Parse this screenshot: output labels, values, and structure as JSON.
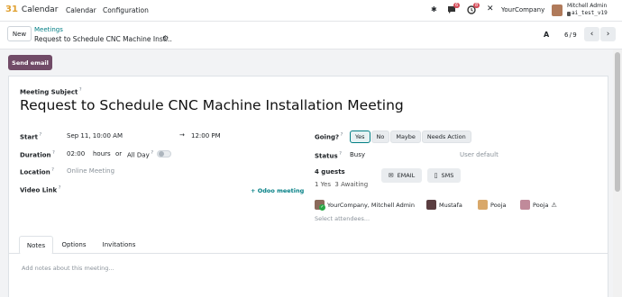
{
  "app": {
    "logo_number": "31",
    "name": "Calendar"
  },
  "menu": {
    "calendar": "Calendar",
    "configuration": "Configuration"
  },
  "systray": {
    "messages_count": "6",
    "activity_count": "8",
    "company": "YourCompany",
    "user_name": "Mitchell Admin",
    "user_db": "ai_test_v19"
  },
  "breadcrumb": {
    "new_label": "New",
    "parent": "Meetings",
    "current": "Request to Schedule CNC Machine Inst..."
  },
  "pager": {
    "value": "6 / 9"
  },
  "actions": {
    "send_email": "Send email"
  },
  "form": {
    "subject_label": "Meeting Subject",
    "subject": "Request to Schedule CNC Machine Installation Meeting",
    "start_label": "Start",
    "start_value": "Sep 11, 10:00 AM",
    "end_value": "12:00 PM",
    "duration_label": "Duration",
    "duration_value": "02:00",
    "duration_unit": "hours",
    "or_text": "or",
    "allday_label": "All Day",
    "location_label": "Location",
    "location_placeholder": "Online Meeting",
    "video_label": "Video Link",
    "odoo_meeting": "Odoo meeting",
    "going_label": "Going?",
    "going_options": [
      "Yes",
      "No",
      "Maybe",
      "Needs Action"
    ],
    "status_label": "Status",
    "status_value": "Busy",
    "user_default": "User default",
    "guests_count": "4 guests",
    "guests_summary": "1 Yes  3 Awaiting",
    "email_button": "EMAIL",
    "sms_button": "SMS",
    "attendees": [
      "YourCompany, Mitchell Admin",
      "Mustafa",
      "Pooja",
      "Pooja"
    ],
    "select_attendees_placeholder": "Select attendees...",
    "tabs": [
      "Notes",
      "Options",
      "Invitations"
    ],
    "notes_placeholder": "Add notes about this meeting..."
  },
  "colors": {
    "brand": "#714b67",
    "teal": "#017e84",
    "badge": "#d44c59"
  }
}
